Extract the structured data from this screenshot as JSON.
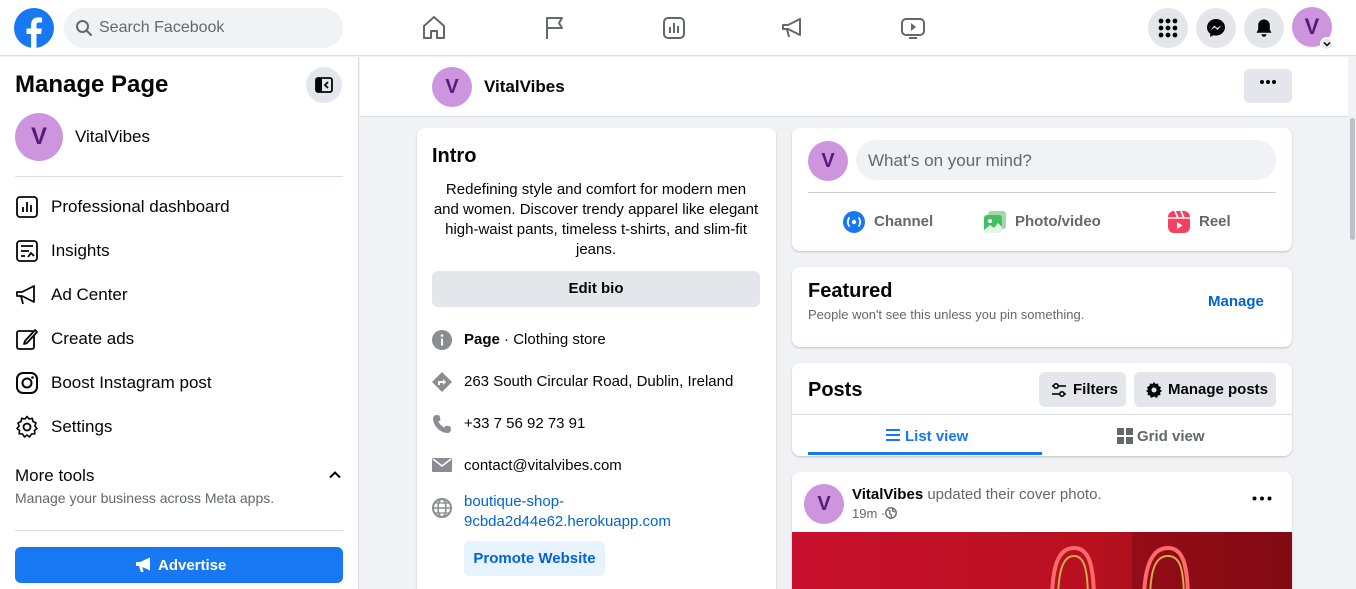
{
  "topbar": {
    "search_placeholder": "Search Facebook",
    "avatar_letter": "V",
    "nav_icons": [
      "home-icon",
      "flag-icon",
      "dashboard-icon",
      "megaphone-icon",
      "video-icon"
    ],
    "right_icons": [
      "menu-grid-icon",
      "messenger-icon",
      "notification-bell-icon"
    ]
  },
  "sidebar": {
    "title": "Manage Page",
    "page_letter": "V",
    "page_name": "VitalVibes",
    "items": [
      {
        "label": "Professional dashboard",
        "icon": "dashboard-icon"
      },
      {
        "label": "Insights",
        "icon": "insights-icon"
      },
      {
        "label": "Ad Center",
        "icon": "megaphone-icon"
      },
      {
        "label": "Create ads",
        "icon": "edit-icon"
      },
      {
        "label": "Boost Instagram post",
        "icon": "instagram-icon"
      },
      {
        "label": "Settings",
        "icon": "gear-icon"
      }
    ],
    "more_tools": "More tools",
    "more_tools_sub": "Manage your business across Meta apps.",
    "advertise": "Advertise"
  },
  "page_header": {
    "letter": "V",
    "name": "VitalVibes"
  },
  "intro": {
    "title": "Intro",
    "bio": "Redefining style and comfort for modern men and women. Discover trendy apparel like elegant high-waist pants, timeless t-shirts, and slim-fit jeans.",
    "edit_bio": "Edit bio",
    "page_label": "Page",
    "category": " · Clothing store",
    "address": "263 South Circular Road, Dublin, Ireland",
    "phone": "+33 7 56 92 73 91",
    "email": "contact@vitalvibes.com",
    "website_line1": "boutique-shop-",
    "website_line2": "9cbda2d44e62.herokuapp.com",
    "promote": "Promote Website"
  },
  "composer": {
    "letter": "V",
    "placeholder": "What's on your mind?",
    "actions": [
      "Channel",
      "Photo/video",
      "Reel"
    ]
  },
  "featured": {
    "title": "Featured",
    "subtitle": "People won't see this unless you pin something.",
    "manage": "Manage"
  },
  "posts": {
    "title": "Posts",
    "filters": "Filters",
    "manage_posts": "Manage posts",
    "tab_list": "List view",
    "tab_grid": "Grid view"
  },
  "post": {
    "letter": "V",
    "author": "VitalVibes",
    "action": " updated their cover photo.",
    "time": "19m ·"
  },
  "colors": {
    "brand": "#1877f2",
    "avatar_bg": "#cc95dd",
    "avatar_fg": "#5a1a78",
    "link": "#0064d1"
  }
}
